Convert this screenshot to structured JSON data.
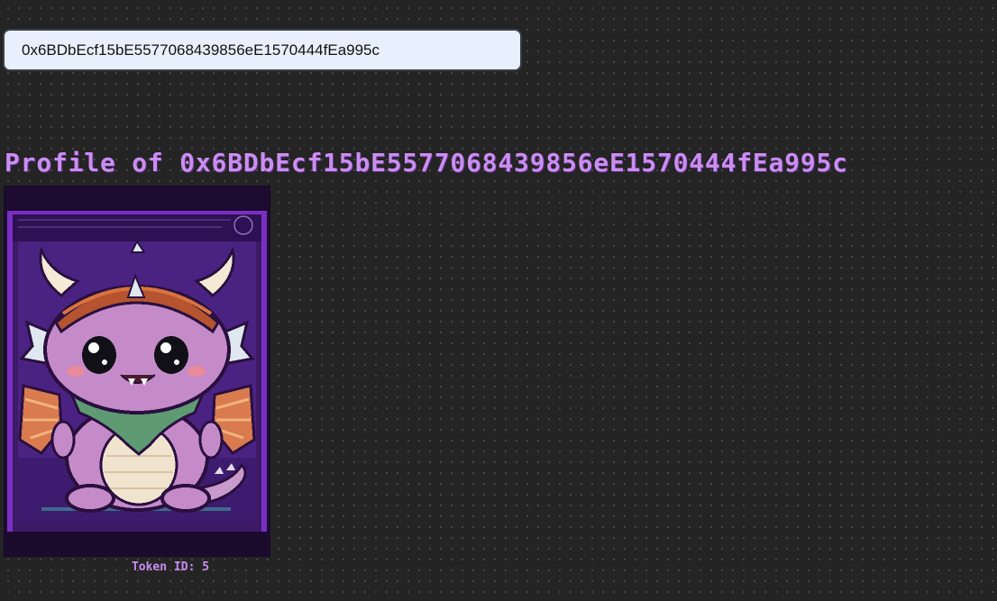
{
  "search": {
    "address_value": "0x6BDbEcf15bE5577068439856eE1570444fEa995c"
  },
  "profile": {
    "title": "Profile of 0x6BDbEcf15bE5577068439856eE1570444fEa995c"
  },
  "nft": {
    "token_label": "Token ID: 5",
    "image_subject": "pixel-dragon"
  },
  "colors": {
    "background": "#242424",
    "accent": "#c98ef0",
    "input_background": "#e8f0fe",
    "card_frame": "#7a2fc4"
  }
}
